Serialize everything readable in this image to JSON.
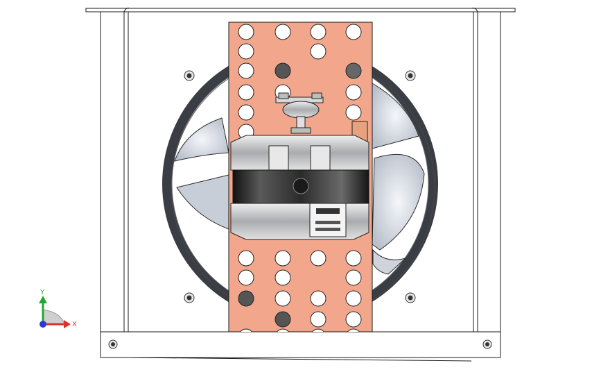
{
  "viewport": {
    "background": "#ffffff"
  },
  "triad": {
    "y_label": "Y",
    "x_label": "X",
    "y_color": "#22a832",
    "x_color": "#e0302a",
    "z_color": "#2a3cd8"
  },
  "colors": {
    "chassis_line": "#1a1a1a",
    "plate_fill": "#f2a78c",
    "fan_frame": "#3a3e44",
    "blade_light": "#d8dde6",
    "motor_body": "#2a2a2a",
    "motor_metal": "#c9cbce"
  }
}
